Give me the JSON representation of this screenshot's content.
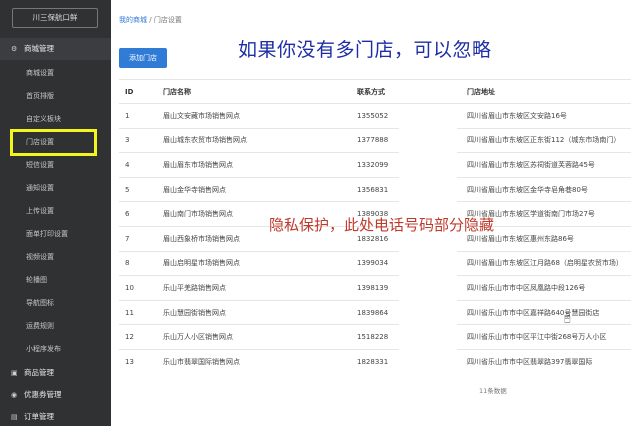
{
  "sidebar": {
    "brand": "川三保航口鲜",
    "groups": [
      {
        "label": "商城管理",
        "icon": "gear-icon",
        "glyph": "⚙"
      },
      {
        "label": "商品管理",
        "icon": "product-icon",
        "glyph": "▣"
      },
      {
        "label": "优惠券管理",
        "icon": "coupon-icon",
        "glyph": "◉"
      },
      {
        "label": "订单管理",
        "icon": "order-icon",
        "glyph": "▤"
      }
    ],
    "items": [
      "商城设置",
      "首页排版",
      "自定义板块",
      "门店设置",
      "短信设置",
      "通知设置",
      "上传设置",
      "面单打印设置",
      "视频设置",
      "轮播图",
      "导航图标",
      "运费规则",
      "小程序发布"
    ]
  },
  "breadcrumb": {
    "home": "我的商城",
    "sep": "/",
    "current": "门店设置"
  },
  "toolbar": {
    "add_label": "添加门店"
  },
  "annotations": {
    "hint": "如果你没有多门店，可以忽略",
    "privacy": "隐私保护，此处电话号码部分隐藏"
  },
  "table": {
    "columns": [
      "ID",
      "门店名称",
      "联系方式",
      "门店地址"
    ],
    "rows": [
      {
        "id": "1",
        "name": "眉山文安藏市场销售网点",
        "phone": "1355052",
        "address": "四川省眉山市东坡区文安路16号"
      },
      {
        "id": "3",
        "name": "眉山城东农贸市场销售网点",
        "phone": "1377888",
        "address": "四川省眉山市东坡区正东街112（城东市场南门）"
      },
      {
        "id": "4",
        "name": "眉山眉东市场销售网点",
        "phone": "1332099",
        "address": "四川省眉山市东坡区苏祠街道芙蓉路45号"
      },
      {
        "id": "5",
        "name": "眉山金华寺销售网点",
        "phone": "1356831",
        "address": "四川省眉山市东坡区金华寺皂角巷80号"
      },
      {
        "id": "6",
        "name": "眉山南门市场销售网点",
        "phone": "1389038",
        "address": "四川省眉山市东坡区学道街南门市场27号"
      },
      {
        "id": "7",
        "name": "眉山西象桥市场销售网点",
        "phone": "1832816",
        "address": "四川省眉山市东坡区惠州东路86号"
      },
      {
        "id": "8",
        "name": "眉山启明星市场销售网点",
        "phone": "1399034",
        "address": "四川省眉山市东坡区江月路68（启明星农贸市场）"
      },
      {
        "id": "10",
        "name": "乐山平羌路销售网点",
        "phone": "1398139",
        "address": "四川省乐山市市中区凤凰路中段126号"
      },
      {
        "id": "11",
        "name": "乐山慧园街销售网点",
        "phone": "1839864",
        "address": "四川省乐山市市中区嘉祥路640号慧园街店"
      },
      {
        "id": "12",
        "name": "乐山万人小区销售网点",
        "phone": "1518228",
        "address": "四川省乐山市市中区平江中街268号万人小区"
      },
      {
        "id": "13",
        "name": "乐山市翡翠国际销售网点",
        "phone": "1828331",
        "address": "四川省乐山市市中区翡翠路397翡翠国际"
      }
    ],
    "total": "11条数据"
  }
}
